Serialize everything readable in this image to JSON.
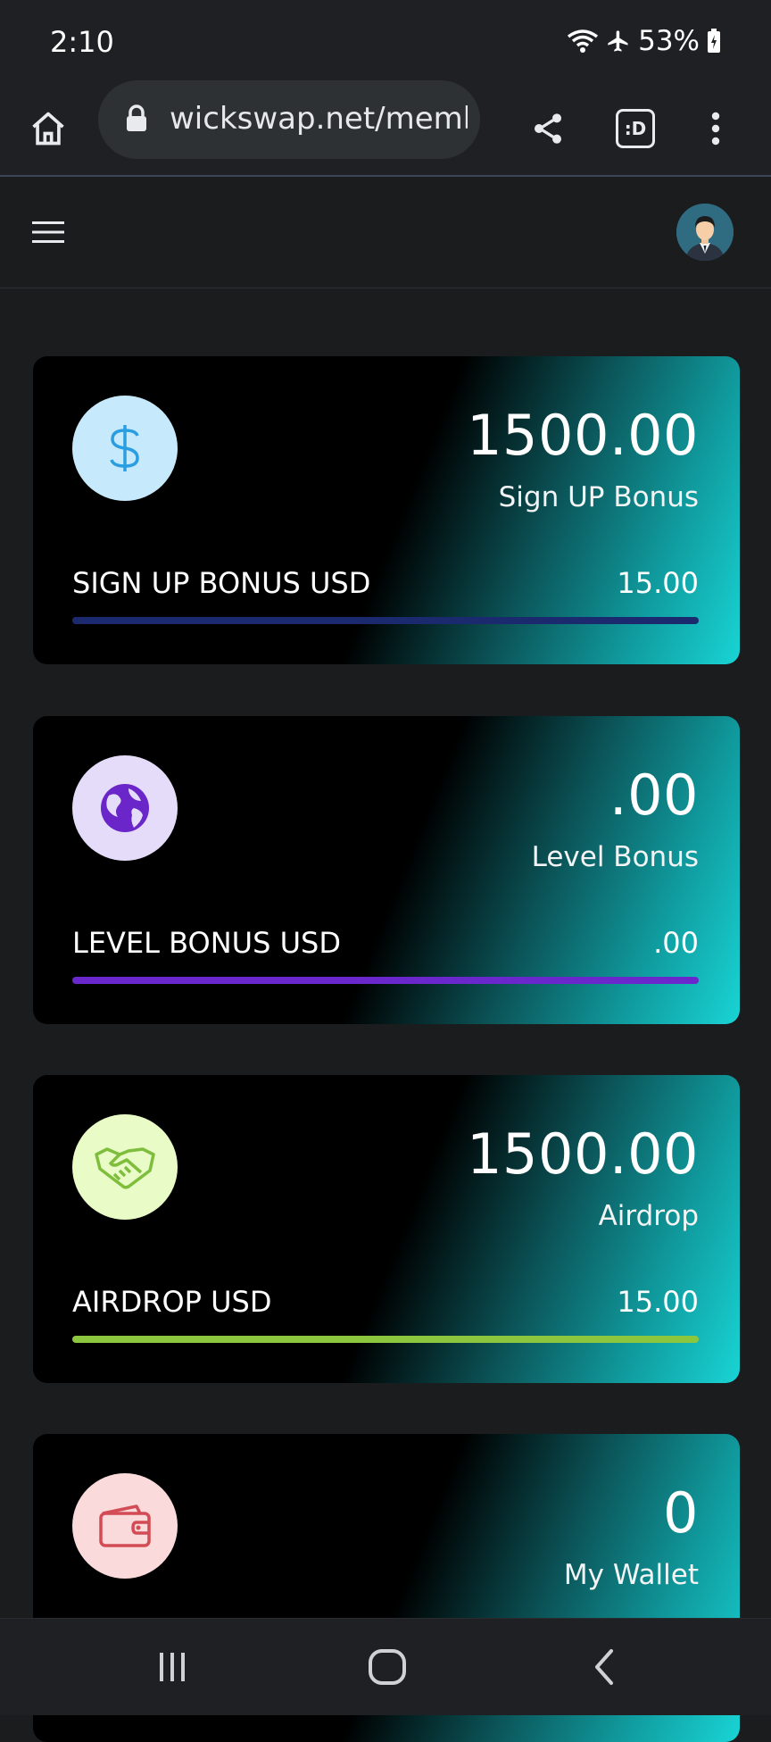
{
  "status_bar": {
    "time": "2:10",
    "battery": "53%",
    "icons": [
      "wifi-icon",
      "airplane-icon",
      "battery-icon"
    ]
  },
  "browser": {
    "url": "wickswap.net/memb",
    "tab_indicator": ":D",
    "icons": [
      "home-icon",
      "lock-icon",
      "share-icon",
      "tabs-icon",
      "more-vert-icon"
    ]
  },
  "app_header": {
    "icons": [
      "hamburger-menu-icon",
      "user-avatar"
    ]
  },
  "cards": [
    {
      "id": "signup-bonus",
      "icon": "dollar-icon",
      "icon_bg": "#c6e9fb",
      "icon_color": "#2a9ee0",
      "value": "1500.00",
      "subtitle": "Sign UP Bonus",
      "label": "SIGN UP BONUS USD",
      "amount": "15.00",
      "bar_color": "#1b2a6e",
      "progress": 1.0
    },
    {
      "id": "level-bonus",
      "icon": "globe-icon",
      "icon_bg": "#e5dcfa",
      "icon_color": "#6a26c8",
      "value": ".00",
      "subtitle": "Level Bonus",
      "label": "LEVEL BONUS USD",
      "amount": ".00",
      "bar_color": "#6a27cc",
      "progress": 1.0
    },
    {
      "id": "airdrop",
      "icon": "handshake-icon",
      "icon_bg": "#e9fbc6",
      "icon_color": "#7fbe3c",
      "value": "1500.00",
      "subtitle": "Airdrop",
      "label": "AIRDROP USD",
      "amount": "15.00",
      "bar_color": "#8cc63f",
      "progress": 1.0
    },
    {
      "id": "my-wallet",
      "icon": "wallet-icon",
      "icon_bg": "#fadada",
      "icon_color": "#d24b55",
      "value": "0",
      "subtitle": "My Wallet"
    }
  ],
  "nav_bar": {
    "icons": [
      "recents-icon",
      "home-circle-icon",
      "back-icon"
    ]
  }
}
